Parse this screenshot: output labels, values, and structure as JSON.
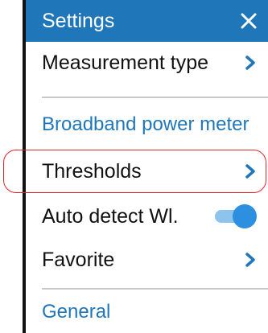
{
  "header": {
    "title": "Settings",
    "close_icon": "close-icon"
  },
  "menu": {
    "measurement_type": "Measurement type",
    "broadband_section": "Broadband power meter",
    "thresholds": "Thresholds",
    "auto_detect": "Auto detect Wl.",
    "auto_detect_on": true,
    "favorite": "Favorite",
    "general_section": "General"
  },
  "colors": {
    "accent": "#1f77b9",
    "toggle_knob": "#2d8fe0",
    "toggle_track": "#8ec3ee",
    "highlight": "#e2262c"
  },
  "icons": {
    "chevron": "chevron-right-icon",
    "close": "close-icon"
  }
}
